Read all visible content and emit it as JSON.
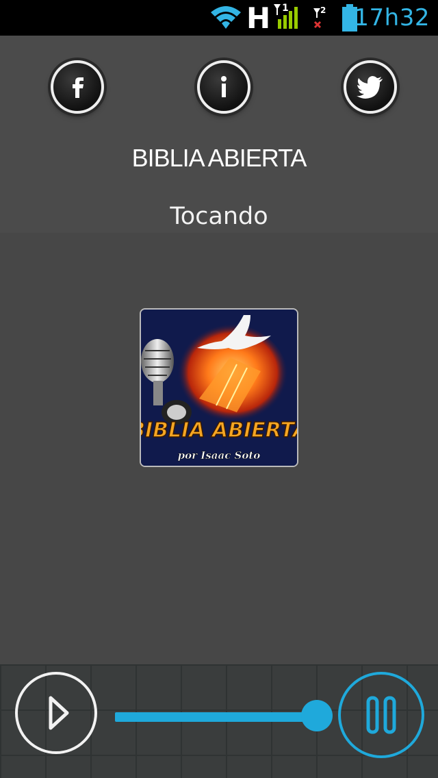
{
  "status_bar": {
    "network_type": "H",
    "sim1_label": "1",
    "sim2_label": "2",
    "time": "17h32",
    "accent_color": "#33b5e5"
  },
  "header": {
    "facebook_icon": "facebook-icon",
    "info_icon": "info-icon",
    "twitter_icon": "twitter-icon",
    "station_title": "BIBLIA ABIERTA",
    "playing_label": "Tocando"
  },
  "cover": {
    "title_text": "BIBLIA ABIERTA",
    "subtitle_text": "por Isaac Soto"
  },
  "player": {
    "play_icon": "play-icon",
    "pause_icon": "pause-icon",
    "volume_level": 0.93,
    "accent_color": "#1fa9db"
  }
}
